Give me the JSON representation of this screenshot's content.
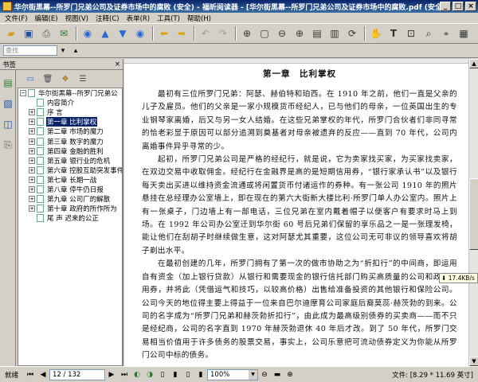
{
  "window": {
    "title": "华尔街黑幕--所罗门兄弟公司及证券市场中的腐败 (安全) - 福昕阅读器 - [华尔街黑幕--所罗门兄弟公司及证券市场中的腐败.pdf (安全)]",
    "min": "_",
    "max": "□",
    "close": "×"
  },
  "menu": [
    {
      "label": "文件(F)"
    },
    {
      "label": "编辑(E)"
    },
    {
      "label": "视图(V)"
    },
    {
      "label": "注释(C)"
    },
    {
      "label": "表单(R)"
    },
    {
      "label": "工具(T)"
    },
    {
      "label": "帮助(H)"
    }
  ],
  "search": {
    "placeholder": "查找"
  },
  "sidebar": {
    "title": "书签",
    "close": "×",
    "items": [
      {
        "label": "华尔街黑幕--所罗门兄弟公",
        "expand": "−",
        "indent": 0,
        "selected": false
      },
      {
        "label": "内容简介",
        "expand": "",
        "indent": 1,
        "selected": false
      },
      {
        "label": "序 言",
        "expand": "+",
        "indent": 1,
        "selected": false
      },
      {
        "label": "第一章 比利掌权",
        "expand": "+",
        "indent": 1,
        "selected": true
      },
      {
        "label": "第二章 市场的魔力",
        "expand": "+",
        "indent": 1,
        "selected": false
      },
      {
        "label": "第三章 数字的魔力",
        "expand": "+",
        "indent": 1,
        "selected": false
      },
      {
        "label": "第四章 金融的胜利",
        "expand": "+",
        "indent": 1,
        "selected": false
      },
      {
        "label": "第五章 银行业的危机",
        "expand": "+",
        "indent": 1,
        "selected": false
      },
      {
        "label": "第六章 控股互助突发事件",
        "expand": "+",
        "indent": 1,
        "selected": false
      },
      {
        "label": "第七章 长期一战",
        "expand": "+",
        "indent": 1,
        "selected": false
      },
      {
        "label": "第八章 停牛仍日报",
        "expand": "+",
        "indent": 1,
        "selected": false
      },
      {
        "label": "第九章 公司厂的解散",
        "expand": "+",
        "indent": 1,
        "selected": false
      },
      {
        "label": "第十章 政府的所作所为",
        "expand": "+",
        "indent": 1,
        "selected": false
      },
      {
        "label": "尾 声 迟来的公正",
        "expand": "",
        "indent": 1,
        "selected": false
      }
    ]
  },
  "document": {
    "heading": "第一章　比利掌权",
    "paragraphs": [
      "最初有三位所罗门兄弟：阿瑟、赫伯特和珀西。在 1910 年之前，他们一直是父亲的儿子及雇员。他们的父亲是一家小规模货币经纪人，已与他们的母亲，一位英国出生的专业钢琴家离婚，后又与另一女人结婚。在这些兄弟掌权的年代，所罗门合伙者们非同寻常的恰老彩显于原因可以部分追溯到奠基者对母亲被遗弃的反应——直到 70 年代，公司内离婚事件异乎寻常的少。",
      "起初，所罗门兄弟公司是严格的经纪行，就是说，它为卖家找买家，为买家找卖家，在双边交易中收取佣金。经纪行在金融界是高的是短期信用券，“银行家承认书”以及银行每天卖出买进以维持资金流通或将闲置货币付诸运作的券种。有一张公司 1910 年的照片悬挂在总经理办公室墙上，即在现在的第六大街新大楼比利·所罗门单人办公室内。照片上有一张桌子，门边墙上有一部电话，三位兄弟在室内戴着帽子以便客户有要求时马上到场。在 1992 年公司办公室迁到华尔街 60 号后兄弟们保留的享乐品之一是一张理发椅，能让他们在刮胡子时继续做生意，这对阿瑟尤其重要，这位公司无可非议的领导喜欢将胡子剃出水平。",
      "在最初创建的几年，所罗门拥有了第一次的做市协助之为“折扣行”的中间商，即运用自有资金（加上银行贷款）从银行和需要现金的银行信托部门购买高质量的公司和政府债用券，并将此（凭借运气和技巧，以较高价格）出售给准备投资的其他银行和保险公司。公司今天的地位得主要上得益于一位来自巴尔迪摩育公司家庭后裔莫蕊·赫茨勃的到来。公司的名字成为“所罗门兄弟和赫茨勃折扣行”，由此成为最高级别债券的买卖商——而不只是经纪商，公司的名字直到 1970 年赫茨勃退休 40 年后才改。到了 50 年代，所罗门交易相当价值用于许多债务的股票交易，事实上，公司乐意把可流动债券定义为你能从所罗门公司中标的债务。"
    ]
  },
  "tooltip": {
    "size": "17.4KB/s"
  },
  "status": {
    "ready": "就绪",
    "page": "12 / 132",
    "zoom": "100%",
    "docsize": "文件: [8.29 * 11.69 英寸]"
  }
}
